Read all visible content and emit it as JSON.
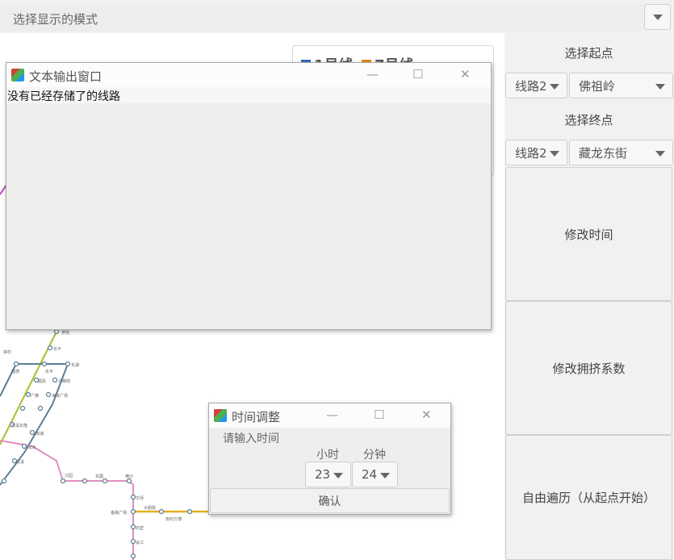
{
  "mode_bar": {
    "label": "选择显示的模式"
  },
  "legend": {
    "items": [
      {
        "label": "1号线",
        "color": "#3a6ab5"
      },
      {
        "label": "7号线",
        "color": "#e08a1e"
      }
    ]
  },
  "map_stations": [
    "萝岗",
    "长平",
    "钟村",
    "猎德",
    "东平",
    "东湖",
    "富民",
    "浔峰岗",
    "广佛",
    "海珠广场",
    "汉溪长隆",
    "南浦",
    "南洲",
    "龙溪",
    "沙园",
    "东圃",
    "横沙",
    "华师",
    "大剧院",
    "南村万博",
    "番禺广场",
    "石壁",
    "会江"
  ],
  "right_panel": {
    "start_label": "选择起点",
    "start_line": "线路2",
    "start_station": "佛祖岭",
    "end_label": "选择终点",
    "end_line": "线路2",
    "end_station": "藏龙东街",
    "modify_time": "修改时间",
    "modify_crowd": "修改拥挤系数",
    "free_traverse": "自由遍历（从起点开始）"
  },
  "output_window": {
    "title": "文本输出窗口",
    "minimize": "—",
    "maximize": "☐",
    "close": "✕",
    "content": "没有已经存储了的线路"
  },
  "time_window": {
    "title": "时间调整",
    "minimize": "—",
    "maximize": "☐",
    "close": "✕",
    "prompt": "请输入时间",
    "hour_label": "小时",
    "minute_label": "分钟",
    "hour_value": "23",
    "minute_value": "24",
    "confirm": "确认"
  }
}
